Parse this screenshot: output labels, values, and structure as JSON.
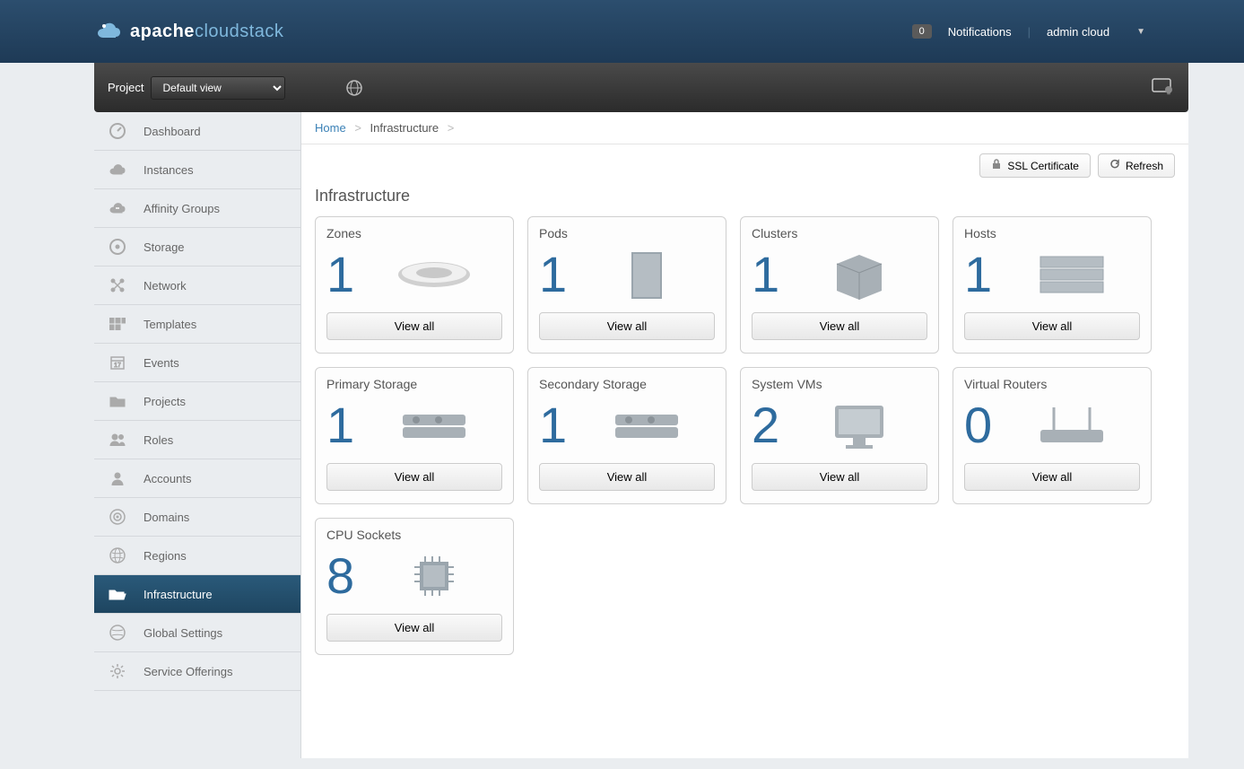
{
  "header": {
    "brand_bold": "apache",
    "brand_light": "cloudstack",
    "notif_count": "0",
    "notif_label": "Notifications",
    "user": "admin cloud"
  },
  "toolbar": {
    "project_label": "Project",
    "project_selected": "Default view"
  },
  "breadcrumb": {
    "home": "Home",
    "current": "Infrastructure"
  },
  "actions": {
    "ssl": "SSL Certificate",
    "refresh": "Refresh"
  },
  "page_title": "Infrastructure",
  "sidebar": {
    "items": [
      {
        "label": "Dashboard"
      },
      {
        "label": "Instances"
      },
      {
        "label": "Affinity Groups"
      },
      {
        "label": "Storage"
      },
      {
        "label": "Network"
      },
      {
        "label": "Templates"
      },
      {
        "label": "Events"
      },
      {
        "label": "Projects"
      },
      {
        "label": "Roles"
      },
      {
        "label": "Accounts"
      },
      {
        "label": "Domains"
      },
      {
        "label": "Regions"
      },
      {
        "label": "Infrastructure"
      },
      {
        "label": "Global Settings"
      },
      {
        "label": "Service Offerings"
      }
    ]
  },
  "cards": [
    {
      "title": "Zones",
      "count": "1",
      "btn": "View all"
    },
    {
      "title": "Pods",
      "count": "1",
      "btn": "View all"
    },
    {
      "title": "Clusters",
      "count": "1",
      "btn": "View all"
    },
    {
      "title": "Hosts",
      "count": "1",
      "btn": "View all"
    },
    {
      "title": "Primary Storage",
      "count": "1",
      "btn": "View all"
    },
    {
      "title": "Secondary Storage",
      "count": "1",
      "btn": "View all"
    },
    {
      "title": "System VMs",
      "count": "2",
      "btn": "View all"
    },
    {
      "title": "Virtual Routers",
      "count": "0",
      "btn": "View all"
    },
    {
      "title": "CPU Sockets",
      "count": "8",
      "btn": "View all"
    }
  ]
}
